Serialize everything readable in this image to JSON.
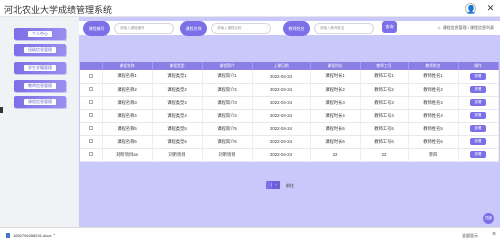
{
  "app": {
    "title": "河北农业大学成绩管理系统",
    "icons": [
      "user-icon",
      "logout-icon"
    ]
  },
  "sidebar": {
    "items": [
      {
        "label": "个人中心"
      },
      {
        "label": "班级信息管理"
      },
      {
        "label": "学生学籍管理"
      },
      {
        "label": "教师信息管理"
      },
      {
        "label": "课程信息管理"
      }
    ]
  },
  "panel": {
    "title": "课程信息管理",
    "breadcrumb": "课程信息管理 / 课程信息列表"
  },
  "filters": {
    "course_id_label": "课程编号",
    "course_id_placeholder": "请输入课程编号",
    "course_name_label": "课程名称",
    "course_name_placeholder": "请输入课程名称",
    "teacher_label": "教师姓名",
    "teacher_placeholder": "请输入教师姓名",
    "search_label": "查询"
  },
  "table": {
    "headers": [
      "",
      "课程名称",
      "课程类型",
      "课程简介",
      "上课日期",
      "课程时长",
      "教师工号",
      "教师姓名",
      "操作"
    ],
    "rows": [
      [
        "课程名称1",
        "课程类型1",
        "课程简介1",
        "2022-04-24",
        "课程时长1",
        "教师工号1",
        "教师姓名1",
        "查看"
      ],
      [
        "课程名称2",
        "课程类型2",
        "课程简介2",
        "2022-04-24",
        "课程时长2",
        "教师工号2",
        "教师姓名2",
        "查看"
      ],
      [
        "课程名称3",
        "课程类型3",
        "课程简介3",
        "2022-04-24",
        "课程时长3",
        "教师工号3",
        "教师姓名3",
        "查看"
      ],
      [
        "课程名称4",
        "课程类型4",
        "课程简介4",
        "2022-04-24",
        "课程时长4",
        "教师工号4",
        "教师姓名4",
        "查看"
      ],
      [
        "课程名称5",
        "课程类型5",
        "课程简介5",
        "2022-04-24",
        "课程时长5",
        "教师工号5",
        "教师姓名5",
        "查看"
      ],
      [
        "课程名称6",
        "课程类型6",
        "课程简介6",
        "2022-04-24",
        "课程时长6",
        "教师工号6",
        "教师姓名6",
        "查看"
      ],
      [
        "刘昕项目as",
        "刘昕项目",
        "刘昕项目",
        "2022-04-24",
        "22",
        "22",
        "李四",
        "查看"
      ]
    ]
  },
  "pager": {
    "page_size": "10",
    "goto_label": "前往"
  },
  "fab_label": "顶部",
  "downloads": {
    "file_name": "1650796288291.docx",
    "show_all": "全部显示",
    "close": "×"
  },
  "colors": {
    "accent": "#7b70e8",
    "main_bg": "#c8c9fa"
  }
}
